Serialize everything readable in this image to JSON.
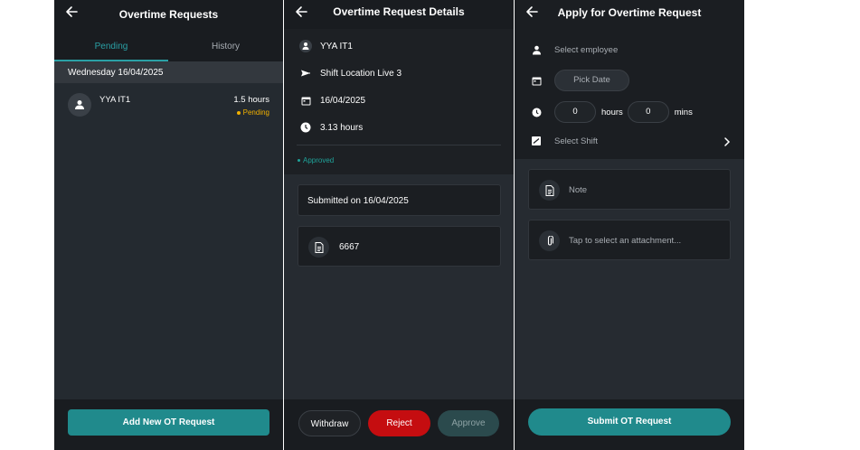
{
  "list_screen": {
    "title": "Overtime Requests",
    "tabs": [
      {
        "label": "Pending",
        "active": true
      },
      {
        "label": "History",
        "active": false
      }
    ],
    "date_header": "Wednesday 16/04/2025",
    "requests": [
      {
        "name": "YYA IT1",
        "hours": "1.5 hours",
        "status": "Pending",
        "status_color": "#f0b000"
      }
    ],
    "add_button": "Add New OT Request",
    "icons": {
      "back": "arrow-left-icon",
      "avatar": "person-icon"
    }
  },
  "detail_screen": {
    "title": "Overtime Request Details",
    "employee": "YYA IT1",
    "location": "Shift Location Live 3",
    "date": "16/04/2025",
    "duration": "3.13 hours",
    "status": "Approved",
    "status_color": "#1fa39a",
    "submitted": "Submitted on 16/04/2025",
    "note": "6667",
    "buttons": {
      "withdraw": "Withdraw",
      "reject": "Reject",
      "approve": "Approve"
    },
    "colors": {
      "reject": "#c50d10",
      "approve": "#2b4a4d"
    },
    "icons": {
      "employee": "person-icon",
      "location": "plane-icon",
      "date": "calendar-icon",
      "duration": "clock-icon",
      "note": "document-icon"
    }
  },
  "apply_screen": {
    "title": "Apply for Overtime Request",
    "employee_placeholder": "Select employee",
    "date_button": "Pick Date",
    "hours_value": "0",
    "hours_unit": "hours",
    "mins_value": "0",
    "mins_unit": "mins",
    "shift_placeholder": "Select Shift",
    "note_placeholder": "Note",
    "attachment_placeholder": "Tap to select an attachment...",
    "submit_button": "Submit OT Request",
    "icons": {
      "employee": "person-icon",
      "date": "calendar-icon",
      "time": "timer-icon",
      "shift": "shift-icon",
      "shift_chevron": "chevron-right-icon",
      "note": "document-icon",
      "attachment": "paperclip-icon"
    }
  },
  "colors": {
    "accent": "#208a8c",
    "tab_active": "#2aa0a5",
    "background": "#242a30",
    "bar": "#191c20"
  }
}
